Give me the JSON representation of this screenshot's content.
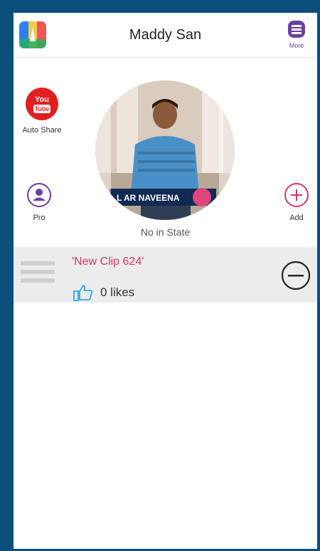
{
  "header": {
    "title": "Maddy San",
    "more_label": "More"
  },
  "profile": {
    "auto_share_label": "Auto Share",
    "pro_label": "Pro",
    "add_label": "Add",
    "state_text": "No in State",
    "youtube_logo_top": "You",
    "youtube_logo_bottom": "Tube",
    "photo_banner_text": "L AR NAVEENA"
  },
  "clip": {
    "title": "'New Clip 624'",
    "likes_text": "0 likes"
  },
  "colors": {
    "frame_bg": "#0b4f7c",
    "accent_purple": "#6a3fa0",
    "accent_pink": "#d6336c",
    "youtube_red": "#e02020",
    "like_blue": "#1aa0e6"
  },
  "icons": {
    "app": "app-logo-icon",
    "more": "more-icon",
    "youtube": "youtube-icon",
    "pro": "user-icon",
    "add": "plus-circle-icon",
    "like": "thumbs-up-icon",
    "remove": "minus-circle-icon"
  }
}
